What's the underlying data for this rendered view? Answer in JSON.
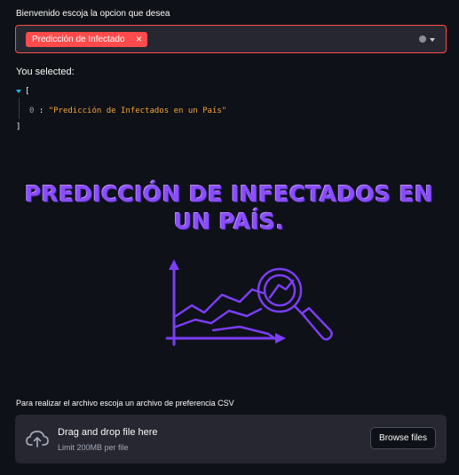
{
  "selector": {
    "label": "Bienvenido escoja la opcion que desea",
    "selected_tag": "Predicción de Infectados en un País",
    "tag_close": "×"
  },
  "selection_output": {
    "label": "You selected:",
    "json_open": "[",
    "json_index": "0",
    "json_separator": " : ",
    "json_value": "\"Predicción de Infectados en un País\"",
    "json_close": "]"
  },
  "hero": {
    "title": "PREDICCIÓN DE INFECTADOS EN UN PAÍS."
  },
  "uploader": {
    "label": "Para realizar el archivo escoja un archivo de preferencia CSV",
    "drop_title": "Drag and drop file here",
    "limit": "Limit 200MB per file",
    "browse_label": "Browse files"
  },
  "colors": {
    "accent": "#ff4b4b",
    "hero_purple": "#8b4dff",
    "illustration": "#7b3df5",
    "json_string": "#f6a43a",
    "background": "#0e1117",
    "widget_bg": "#262730"
  },
  "icons": [
    "close-icon",
    "clear-icon",
    "chevron-down-icon",
    "expand-icon",
    "chart-magnifier-illustration",
    "cloud-upload-icon"
  ]
}
